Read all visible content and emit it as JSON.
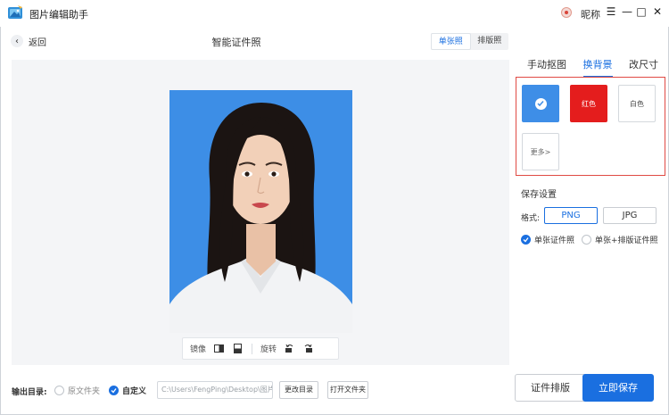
{
  "app": {
    "title": "图片编辑助手",
    "nickname": "昵称"
  },
  "window_controls": {
    "menu": "☰",
    "minimize": "—",
    "maximize": "□",
    "close": "✕"
  },
  "toolbar": {
    "back_label": "返回",
    "page_title": "智能证件照",
    "mode_tabs": [
      {
        "label": "单张照",
        "active": true
      },
      {
        "label": "排版照",
        "active": false
      }
    ]
  },
  "photo_toolbar": {
    "mirror_label": "镜像",
    "rotate_label": "旋转"
  },
  "right_panel": {
    "tabs": [
      {
        "label": "手动抠图"
      },
      {
        "label": "换背景",
        "active": true
      },
      {
        "label": "改尺寸"
      }
    ],
    "backgrounds": {
      "blue_color": "#3e8ee7",
      "red_label": "红色",
      "red_color": "#e41d1d",
      "white_label": "白色",
      "more_label": "更多>"
    },
    "save_settings_title": "保存设置",
    "format_label": "格式:",
    "formats": {
      "png": "PNG",
      "jpg": "JPG",
      "selected": "PNG"
    },
    "output_options": {
      "single": "单张证件照",
      "single_layout": "单张+排版证件照",
      "selected": "single"
    }
  },
  "bottom_bar": {
    "output_dir_label": "输出目录:",
    "option_original": "原文件夹",
    "option_custom": "自定义",
    "selected": "custom",
    "path_value": "C:\\Users\\FengPing\\Desktop\\图片\\",
    "change_dir_label": "更改目录",
    "open_folder_label": "打开文件夹",
    "layout_button_label": "证件排版",
    "save_button_label": "立即保存"
  },
  "colors": {
    "accent": "#1a6fe0",
    "highlight_border": "#e04a44",
    "photo_background": "#3d8ee6"
  }
}
